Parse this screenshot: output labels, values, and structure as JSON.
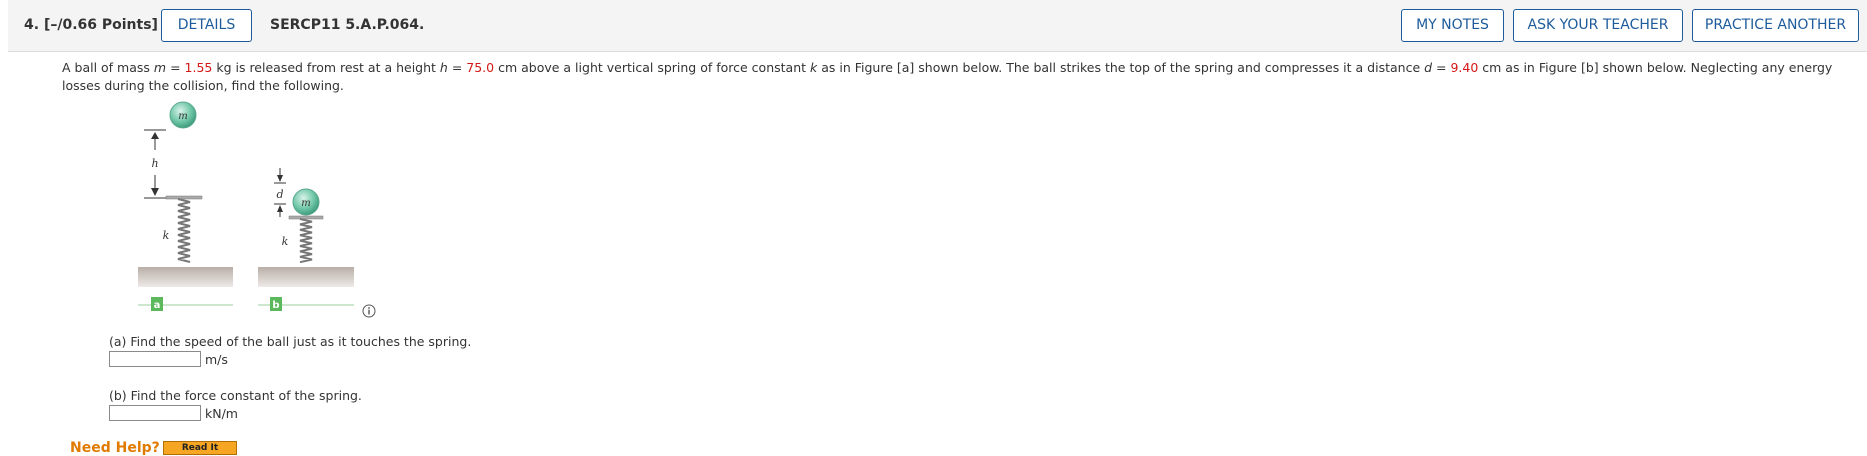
{
  "header": {
    "question_number": "4.",
    "points": "[–/0.66 Points]",
    "details_label": "DETAILS",
    "problem_code": "SERCP11 5.A.P.064.",
    "my_notes_label": "MY NOTES",
    "ask_teacher_label": "ASK YOUR TEACHER",
    "practice_another_label": "PRACTICE ANOTHER"
  },
  "problem": {
    "t1": "A ball of mass ",
    "var_m": "m",
    "t2": " = ",
    "mass_value": "1.55",
    "t3": " kg is released from rest at a height ",
    "var_h": "h",
    "t4": " = ",
    "height_value": "75.0",
    "t5": " cm above a light vertical spring of force constant ",
    "var_k": "k",
    "t6": " as in Figure [a] shown below. The ball strikes the top of the spring and compresses it a distance ",
    "var_d": "d",
    "t7": " = ",
    "distance_value": "9.40",
    "t8": " cm as in Figure [b] shown below. Neglecting any energy losses during the collision, find the following."
  },
  "figure": {
    "label_m": "m",
    "label_h": "h",
    "label_k": "k",
    "label_d": "d",
    "label_a": "a",
    "label_b": "b"
  },
  "parts": [
    {
      "prompt": "(a) Find the speed of the ball just as it touches the spring.",
      "value": "",
      "unit": "m/s"
    },
    {
      "prompt": "(b) Find the force constant of the spring.",
      "value": "",
      "unit": "kN/m"
    }
  ],
  "help": {
    "need_help": "Need Help?",
    "read_it": "Read It"
  },
  "colors": {
    "accent": "#1d5b9b",
    "given_value": "#d41818",
    "need_help": "#e07b00",
    "figure_label": "#5cb85c"
  }
}
